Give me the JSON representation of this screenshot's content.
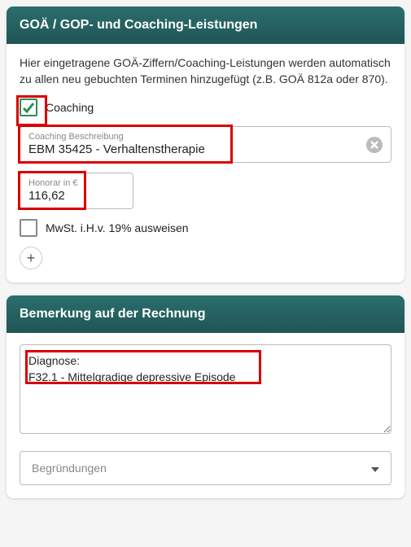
{
  "card1": {
    "title": "GOÄ / GOP- und Coaching-Leistungen",
    "description": "Hier eingetragene GOÄ-Ziffern/Coaching-Leistungen werden automatisch zu allen neu gebuchten Terminen hinzugefügt (z.B. GOÄ 812a oder 870).",
    "coaching_checkbox_label": "Coaching",
    "coaching_checked": true,
    "desc_field": {
      "label": "Coaching Beschreibung",
      "value": "EBM 35425 - Verhaltenstherapie"
    },
    "honorar_field": {
      "label": "Honorar in €",
      "value": "116,62"
    },
    "mwst_label": "MwSt. i.H.v. 19% ausweisen",
    "mwst_checked": false,
    "add_btn": "+"
  },
  "card2": {
    "title": "Bemerkung auf der Rechnung",
    "textarea_value": "Diagnose:\nF32.1 - Mittelgradige depressive Episode",
    "select_placeholder": "Begründungen"
  }
}
